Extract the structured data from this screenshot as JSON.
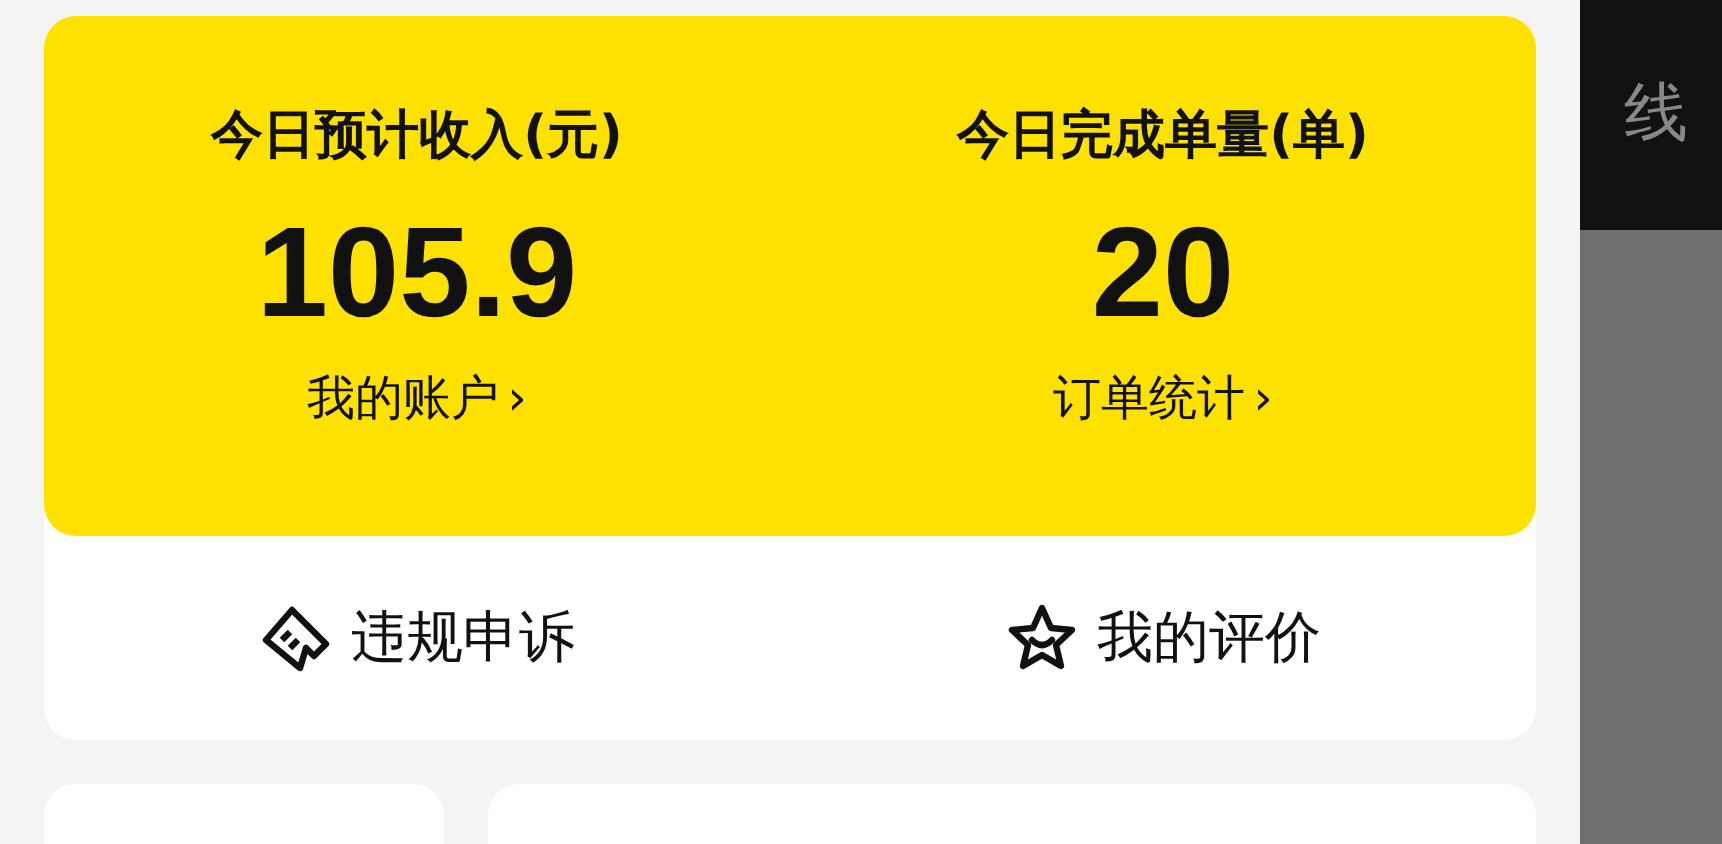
{
  "summary_card": {
    "stats": [
      {
        "label": "今日预计收入(元)",
        "value": "105.9",
        "link": "我的账户",
        "link_arrow": "›"
      },
      {
        "label": "今日完成单量(单)",
        "value": "20",
        "link": "订单统计",
        "link_arrow": "›"
      }
    ],
    "actions": [
      {
        "kind": "appeal",
        "label": "违规申诉"
      },
      {
        "kind": "rating",
        "label": "我的评价"
      }
    ]
  },
  "side_panel": {
    "title": "线"
  }
}
